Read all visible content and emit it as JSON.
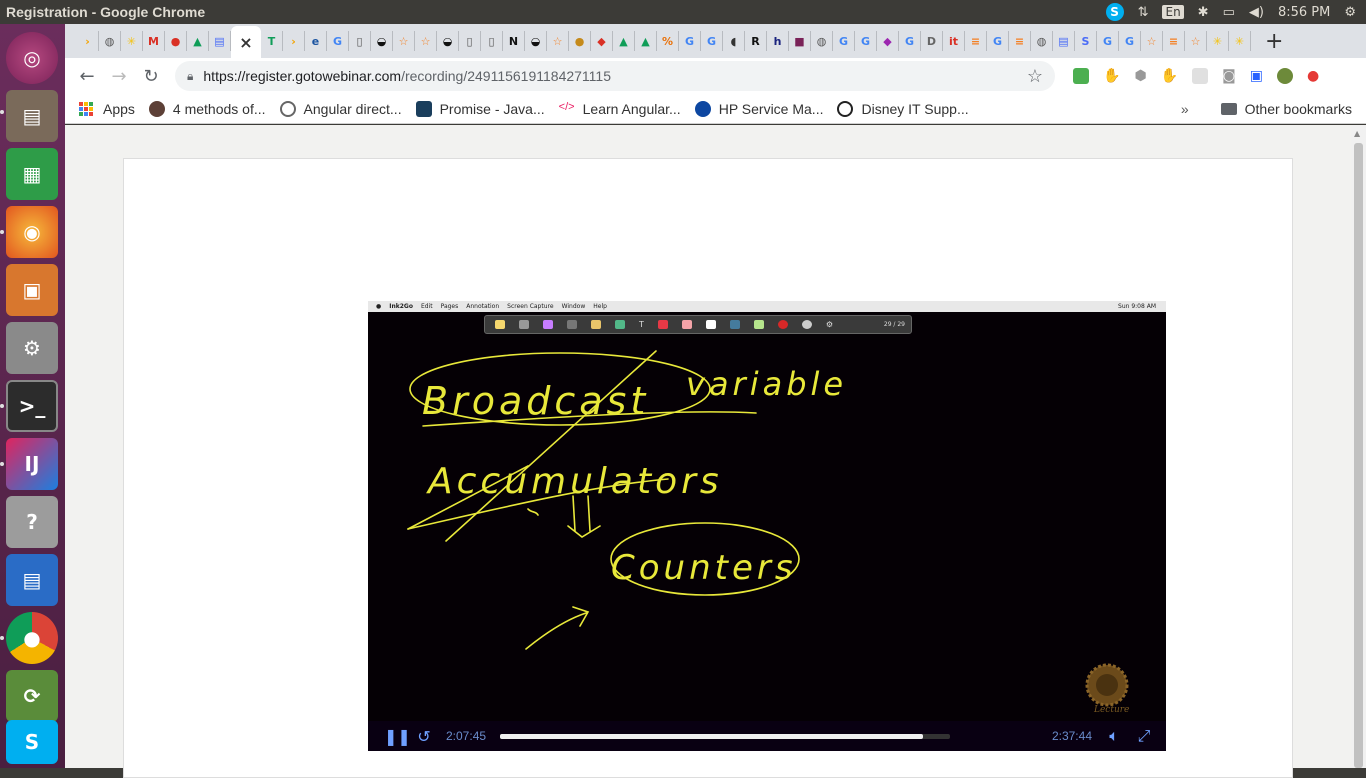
{
  "top_panel": {
    "window_title": "Registration - Google Chrome",
    "language": "En",
    "clock": "8:56 PM"
  },
  "launcher": {
    "apps": [
      "ubuntu-dash",
      "files",
      "libreoffice-calc",
      "firefox",
      "libreoffice-impress",
      "system-settings",
      "terminal",
      "intellij-idea",
      "help",
      "libreoffice-writer",
      "chrome",
      "software-updater",
      "skype"
    ]
  },
  "tabs": {
    "active_close": "×",
    "new_tab": "+"
  },
  "toolbar": {
    "url_host": "https://register.gotowebinar.com",
    "url_path": "/recording/2491156191184271115"
  },
  "bookmarks": {
    "apps_label": "Apps",
    "items": [
      "4 methods of...",
      "Angular direct...",
      "Promise - Java...",
      "Learn Angular...",
      "HP Service Ma...",
      "Disney IT Supp..."
    ],
    "more": "»",
    "other": "Other bookmarks"
  },
  "video": {
    "mac_app": "Ink2Go",
    "mac_menus": [
      "Edit",
      "Pages",
      "Annotation",
      "Screen Capture",
      "Window",
      "Help"
    ],
    "mac_status": "Sun 9:08 AM",
    "ink_page_count": "29 / 29",
    "handwriting": {
      "broadcast": "Broadcast",
      "variable": "variable",
      "accumulator": "Accumulators",
      "counters": "Counters"
    },
    "watermark_text": "Lecture",
    "current_time": "2:07:45",
    "duration": "2:37:44",
    "progress_fraction": 0.94
  },
  "colors": {
    "ink": "#e8e83a",
    "player_accent": "#6fa0ff",
    "launcher_bg": "#5e2750"
  }
}
